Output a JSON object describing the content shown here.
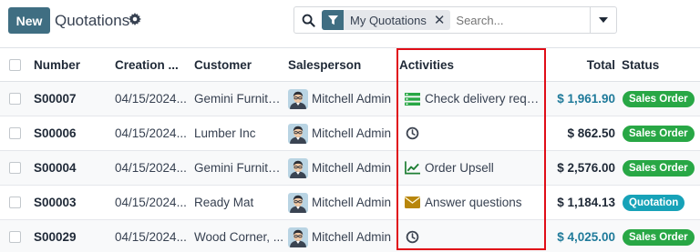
{
  "header": {
    "new_label": "New",
    "title": "Quotations",
    "settings_icon": "gear-icon"
  },
  "search": {
    "facet_icon": "filter-icon",
    "facet_label": "My Quotations",
    "placeholder": "Search..."
  },
  "colors": {
    "primary": "#3f6e82",
    "sale_badge": "#28a745",
    "quotation_badge": "#17a2b8",
    "highlight": "#e00d17",
    "total_link": "#1f7a9a"
  },
  "table": {
    "columns": {
      "number": "Number",
      "creation": "Creation ...",
      "customer": "Customer",
      "salesperson": "Salesperson",
      "activities": "Activities",
      "total": "Total",
      "status": "Status"
    },
    "rows": [
      {
        "number": "S00007",
        "date": "04/15/2024...",
        "customer": "Gemini Furnitu...",
        "salesperson": "Mitchell Admin",
        "activity_icon": "todo-list-icon",
        "activity": "Check delivery requir...",
        "total": "$ 1,961.90",
        "total_link": true,
        "status": "Sales Order",
        "status_kind": "sale"
      },
      {
        "number": "S00006",
        "date": "04/15/2024...",
        "customer": "Lumber Inc",
        "salesperson": "Mitchell Admin",
        "activity_icon": "clock-icon",
        "activity": "",
        "total": "$ 862.50",
        "total_link": false,
        "status": "Sales Order",
        "status_kind": "sale"
      },
      {
        "number": "S00004",
        "date": "04/15/2024...",
        "customer": "Gemini Furnitu...",
        "salesperson": "Mitchell Admin",
        "activity_icon": "upsell-chart-icon",
        "activity": "Order Upsell",
        "total": "$ 2,576.00",
        "total_link": false,
        "status": "Sales Order",
        "status_kind": "sale"
      },
      {
        "number": "S00003",
        "date": "04/15/2024...",
        "customer": "Ready Mat",
        "salesperson": "Mitchell Admin",
        "activity_icon": "envelope-icon",
        "activity": "Answer questions",
        "total": "$ 1,184.13",
        "total_link": false,
        "status": "Quotation",
        "status_kind": "quotation"
      },
      {
        "number": "S00029",
        "date": "04/15/2024...",
        "customer": "Wood Corner, ...",
        "salesperson": "Mitchell Admin",
        "activity_icon": "clock-icon",
        "activity": "",
        "total": "$ 4,025.00",
        "total_link": true,
        "status": "Sales Order",
        "status_kind": "sale"
      }
    ]
  }
}
